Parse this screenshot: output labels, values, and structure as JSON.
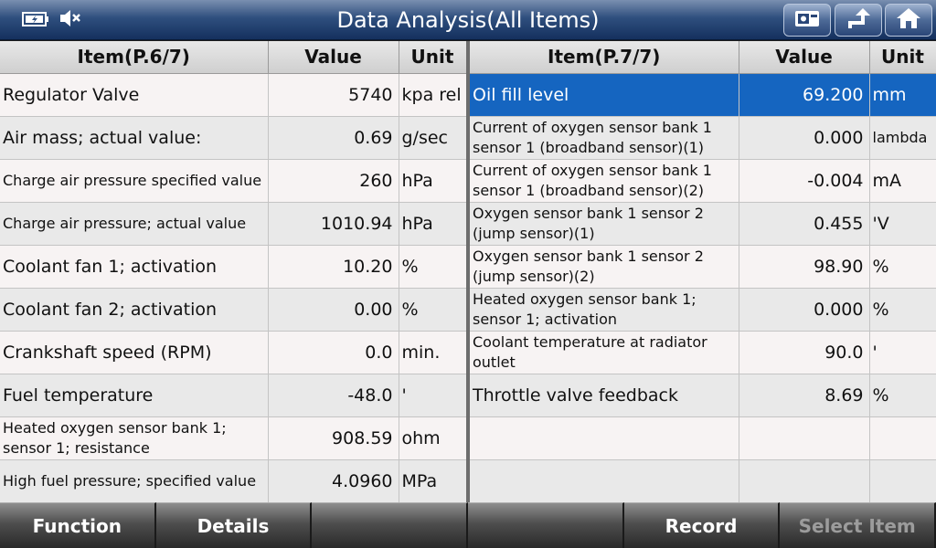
{
  "header": {
    "title": "Data Analysis(All Items)",
    "icons": [
      "battery-icon",
      "mute-icon",
      "screenshot-icon",
      "back-icon",
      "home-icon"
    ]
  },
  "left": {
    "columns": [
      "Item(P.6/7)",
      "Value",
      "Unit"
    ],
    "rows": [
      {
        "item": "Regulator Valve",
        "value": "5740",
        "unit": "kpa rel"
      },
      {
        "item": "Air mass; actual value:",
        "value": "0.69",
        "unit": "g/sec"
      },
      {
        "item": "Charge air pressure specified value",
        "value": "260",
        "unit": "hPa"
      },
      {
        "item": "Charge air pressure; actual value",
        "value": "1010.94",
        "unit": "hPa"
      },
      {
        "item": "Coolant fan 1; activation",
        "value": "10.20",
        "unit": "%"
      },
      {
        "item": "Coolant fan 2; activation",
        "value": "0.00",
        "unit": "%"
      },
      {
        "item": "Crankshaft speed (RPM)",
        "value": "0.0",
        "unit": "min."
      },
      {
        "item": "Fuel temperature",
        "value": "-48.0",
        "unit": "'"
      },
      {
        "item": "Heated oxygen sensor bank 1; sensor 1; resistance",
        "value": "908.59",
        "unit": "ohm"
      },
      {
        "item": "High fuel pressure; specified value",
        "value": "4.0960",
        "unit": "MPa"
      }
    ]
  },
  "right": {
    "columns": [
      "Item(P.7/7)",
      "Value",
      "Unit"
    ],
    "rows": [
      {
        "item": "Oil fill level",
        "value": "69.200",
        "unit": "mm"
      },
      {
        "item": "Current of oxygen sensor bank 1 sensor 1 (broadband sensor)(1)",
        "value": "0.000",
        "unit": "lambda"
      },
      {
        "item": "Current of oxygen sensor bank 1 sensor 1 (broadband sensor)(2)",
        "value": "-0.004",
        "unit": "mA"
      },
      {
        "item": "Oxygen sensor bank 1 sensor 2 (jump sensor)(1)",
        "value": "0.455",
        "unit": "'V"
      },
      {
        "item": "Oxygen sensor bank 1 sensor 2 (jump sensor)(2)",
        "value": "98.90",
        "unit": "%"
      },
      {
        "item": "Heated oxygen sensor bank 1; sensor 1; activation",
        "value": "0.000",
        "unit": "%"
      },
      {
        "item": "Coolant temperature at radiator outlet",
        "value": "90.0",
        "unit": "'"
      },
      {
        "item": "Throttle valve feedback",
        "value": "8.69",
        "unit": "%"
      },
      {
        "item": "",
        "value": "",
        "unit": ""
      },
      {
        "item": "",
        "value": "",
        "unit": ""
      }
    ]
  },
  "footer": {
    "buttons": [
      "Function",
      "Details",
      "",
      "",
      "Record",
      "Select Item"
    ]
  },
  "colors": {
    "selected_row": "#1565c0",
    "title_bar": "#2f4f7e"
  }
}
